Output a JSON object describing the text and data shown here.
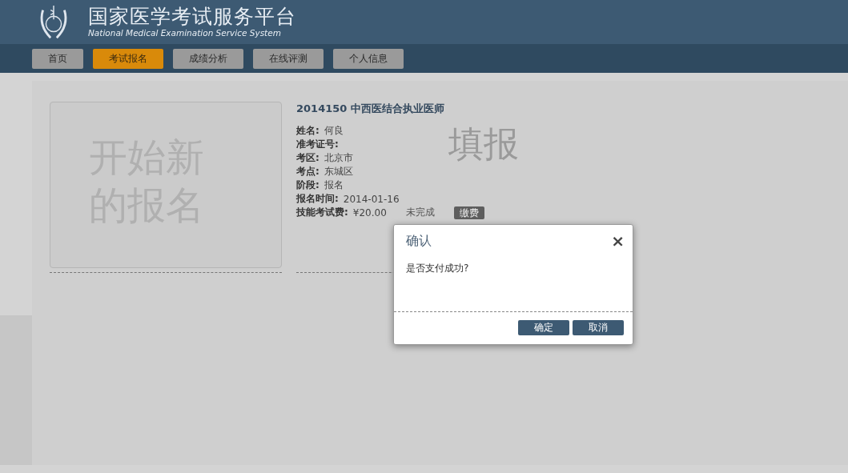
{
  "header": {
    "title": "国家医学考试服务平台",
    "subtitle": "National Medical Examination Service System"
  },
  "nav": [
    {
      "label": "首页",
      "selected": false
    },
    {
      "label": "考试报名",
      "selected": true
    },
    {
      "label": "成绩分析",
      "selected": false
    },
    {
      "label": "在线评测",
      "selected": false
    },
    {
      "label": "个人信息",
      "selected": false
    }
  ],
  "new_card": {
    "label": "开始新的报名"
  },
  "exam": {
    "title": "2014150 中西医结合执业医师",
    "stamp": "填报",
    "fields": [
      {
        "label": "姓名:",
        "value": "何良"
      },
      {
        "label": "准考证号:"
      },
      {
        "label": "考区:",
        "value": "北京市"
      },
      {
        "label": "考点:",
        "value": "东城区"
      },
      {
        "label": "阶段:",
        "value": "报名"
      },
      {
        "label": "报名时间:",
        "value": "2014-01-16"
      },
      {
        "label": "技能考试费:",
        "value": "¥20.00",
        "status": "未完成",
        "action": "缴费"
      }
    ]
  },
  "dialog": {
    "title": "确认",
    "close": "×",
    "message": "是否支付成功?",
    "buttons": [
      "确定",
      "取消"
    ]
  }
}
